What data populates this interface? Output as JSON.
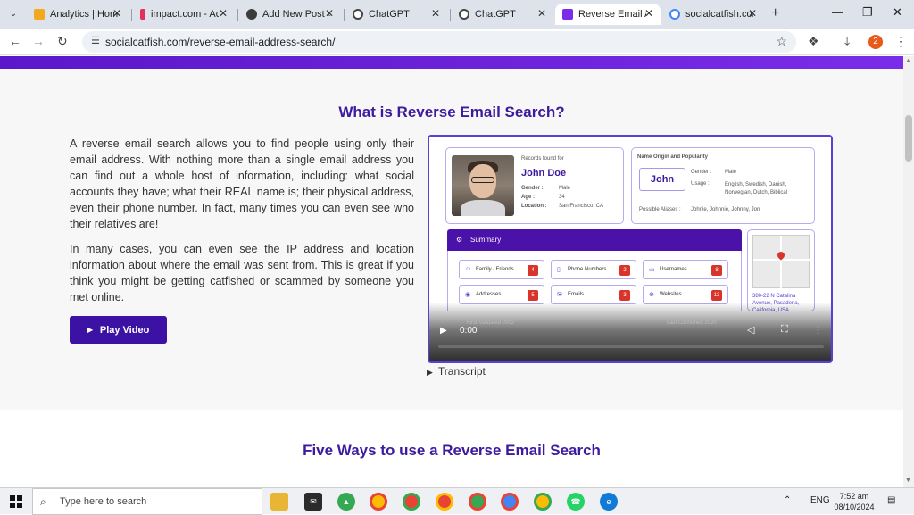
{
  "browser": {
    "tabs": [
      {
        "label": "Analytics | Home",
        "icon": "analytics-icon",
        "color": "#f4a81d"
      },
      {
        "label": "impact.com - Ac",
        "icon": "impact-icon",
        "color": "#e2305a"
      },
      {
        "label": "Add New Post ‹",
        "icon": "wordpress-icon",
        "color": "#3c3c3c"
      },
      {
        "label": "ChatGPT",
        "icon": "chatgpt-icon",
        "color": "#444444"
      },
      {
        "label": "ChatGPT",
        "icon": "chatgpt-icon",
        "color": "#444444"
      },
      {
        "label": "Reverse Email A",
        "icon": "socialcatfish-icon",
        "color": "#7a2de8"
      },
      {
        "label": "socialcatfish.com",
        "icon": "google-icon",
        "color": "#4285f4"
      }
    ],
    "active_tab_index": 5,
    "url": "socialcatfish.com/reverse-email-address-search/",
    "extension_badge": "2"
  },
  "page": {
    "heading": "What is Reverse Email Search?",
    "paragraph1": "A reverse email search allows you to find people using only their email address. With nothing more than a single email address you can find out a whole host of information, including: what social accounts they have; what their REAL name is; their physical address, even their phone number. In fact, many times you can even see who their relatives are!",
    "paragraph2": "In many cases, you can even see the IP address and location information about where the email was sent from. This is great if you think you might be getting catfished or scammed by someone you met online.",
    "play_button": "Play Video",
    "transcript": "Transcript",
    "heading2": "Five Ways to use a Reverse Email Search",
    "accent_color": "#3d1a9e"
  },
  "video": {
    "records_label": "Records found for",
    "name": "John Doe",
    "gender_label": "Gender :",
    "gender": "Male",
    "age_label": "Age :",
    "age": "34",
    "location_label": "Location :",
    "location": "San Francisco, CA",
    "origin_title": "Name Origin and Popularity",
    "origin_name": "John",
    "origin_gender_label": "Gender :",
    "origin_gender": "Male",
    "usage_label": "Usage :",
    "usage": "English, Swedish, Danish, Norwegian, Dutch, Biblical",
    "aliases_label": "Possible Aliases :",
    "aliases": "Johnie, Johnnie, Johnny, Jon",
    "summary_title": "Summary",
    "summary_items": [
      {
        "label": "Family / Friends",
        "count": "4",
        "icon": "people-icon"
      },
      {
        "label": "Phone Numbers",
        "count": "2",
        "icon": "phone-icon"
      },
      {
        "label": "Usernames",
        "count": "8",
        "icon": "chat-icon"
      },
      {
        "label": "Addresses",
        "count": "5",
        "icon": "location-icon"
      },
      {
        "label": "Emails",
        "count": "3",
        "icon": "mail-icon"
      },
      {
        "label": "Websites",
        "count": "13",
        "icon": "globe-icon"
      }
    ],
    "address": "380-22 N Catalina Avenue, Pasadena, California, USA",
    "first_validated": "First Validated 2002",
    "last_confirmed": "Last Confirmed 2020",
    "time": "0:00",
    "progress": 0
  },
  "taskbar": {
    "search_placeholder": "Type here to search",
    "language": "ENG",
    "time": "7:52 am",
    "date": "08/10/2024"
  }
}
